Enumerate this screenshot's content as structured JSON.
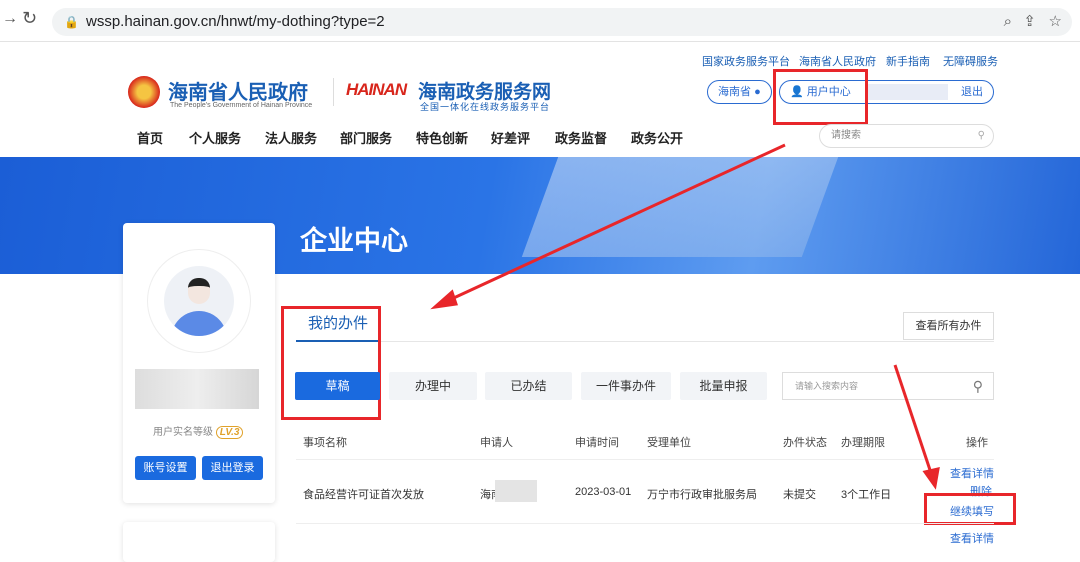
{
  "browser": {
    "url": "wssp.hainan.gov.cn/hnwt/my-dothing?type=2"
  },
  "header": {
    "gov_title": "海南省人民政府",
    "gov_subtitle": "The People's Government of Hainan Province",
    "logo_text": "HAINAN",
    "portal_title": "海南政务服务网",
    "portal_subtitle": "全国一体化在线政务服务平台",
    "top_links": [
      "国家政务服务平台",
      "海南省人民政府",
      "新手指南",
      "无障碍服务"
    ],
    "region": "海南省",
    "user_center": "用户中心",
    "logout": "退出",
    "search_placeholder": "请搜索",
    "nav": [
      "首页",
      "个人服务",
      "法人服务",
      "部门服务",
      "特色创新",
      "好差评",
      "政务监督",
      "政务公开"
    ]
  },
  "banner": {
    "title": "企业中心"
  },
  "profile": {
    "level_label": "用户实名等级",
    "level": "LV.3",
    "account_settings": "账号设置",
    "sign_out": "退出登录"
  },
  "main": {
    "tab": "我的办件",
    "view_all": "查看所有办件",
    "filters": [
      "草稿",
      "办理中",
      "已办结",
      "一件事办件",
      "批量申报"
    ],
    "search_placeholder": "请输入搜索内容",
    "columns": [
      "事项名称",
      "申请人",
      "申请时间",
      "受理单位",
      "办件状态",
      "办理期限",
      "操作"
    ],
    "rows": [
      {
        "name": "食品经营许可证首次发放",
        "applicant": "海南",
        "date": "2023-03-01",
        "unit": "万宁市行政审批服务局",
        "status": "未提交",
        "deadline": "3个工作日",
        "actions": [
          "查看详情",
          "删除",
          "继续填写"
        ]
      }
    ],
    "next_action": "查看详情"
  }
}
